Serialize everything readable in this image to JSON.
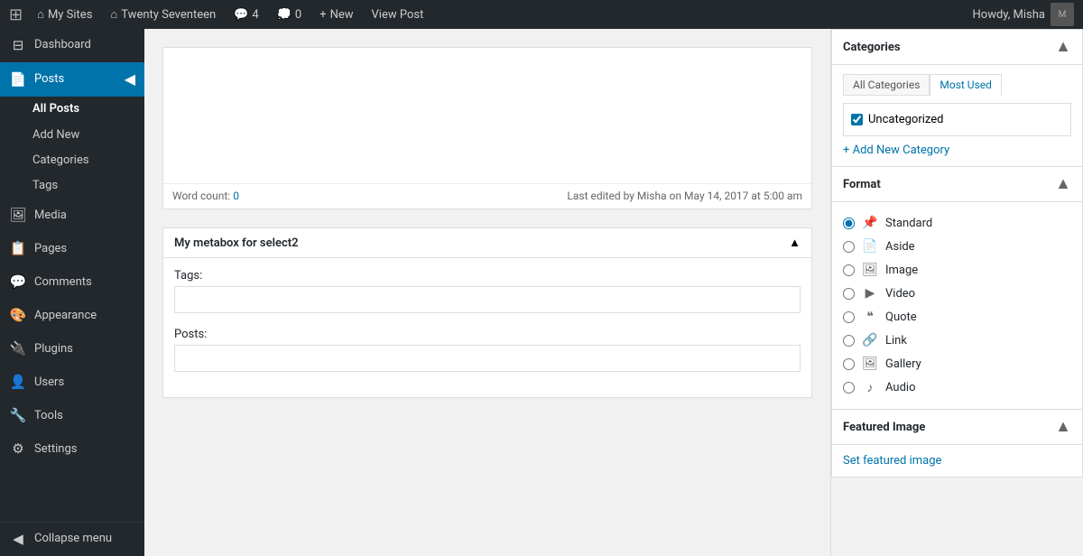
{
  "adminbar": {
    "logo": "⊞",
    "items": [
      {
        "id": "my-sites",
        "icon": "⌂",
        "label": "My Sites"
      },
      {
        "id": "site-name",
        "icon": "⌂",
        "label": "Twenty Seventeen"
      },
      {
        "id": "comments",
        "icon": "💬",
        "label": "4"
      },
      {
        "id": "bubbles",
        "icon": "💭",
        "label": "0"
      },
      {
        "id": "new",
        "icon": "+",
        "label": "New"
      },
      {
        "id": "view-post",
        "label": "View Post"
      }
    ],
    "howdy": "Howdy, Misha"
  },
  "sidebar": {
    "items": [
      {
        "id": "dashboard",
        "icon": "⊟",
        "label": "Dashboard"
      },
      {
        "id": "posts",
        "icon": "📄",
        "label": "Posts",
        "active": true
      },
      {
        "id": "all-posts",
        "label": "All Posts",
        "sub": true,
        "active": true
      },
      {
        "id": "add-new",
        "label": "Add New",
        "sub": true
      },
      {
        "id": "categories",
        "label": "Categories",
        "sub": true
      },
      {
        "id": "tags",
        "label": "Tags",
        "sub": true
      },
      {
        "id": "media",
        "icon": "🖼",
        "label": "Media"
      },
      {
        "id": "pages",
        "icon": "📋",
        "label": "Pages"
      },
      {
        "id": "comments",
        "icon": "💬",
        "label": "Comments"
      },
      {
        "id": "appearance",
        "icon": "🎨",
        "label": "Appearance"
      },
      {
        "id": "plugins",
        "icon": "🔌",
        "label": "Plugins"
      },
      {
        "id": "users",
        "icon": "👤",
        "label": "Users"
      },
      {
        "id": "tools",
        "icon": "🔧",
        "label": "Tools"
      },
      {
        "id": "settings",
        "icon": "⚙",
        "label": "Settings"
      }
    ],
    "collapse_label": "Collapse menu"
  },
  "editor": {
    "word_count_label": "Word count:",
    "word_count_value": "0",
    "last_edited": "Last edited by Misha on May 14, 2017 at 5:00 am"
  },
  "metabox": {
    "title": "My metabox for select2",
    "tags_label": "Tags:",
    "posts_label": "Posts:"
  },
  "categories_panel": {
    "title": "Categories",
    "tab_all": "All Categories",
    "tab_most_used": "Most Used",
    "items": [
      {
        "label": "Uncategorized",
        "checked": true
      }
    ],
    "add_new_label": "+ Add New Category"
  },
  "format_panel": {
    "title": "Format",
    "options": [
      {
        "id": "standard",
        "label": "Standard",
        "icon": "📌",
        "checked": true
      },
      {
        "id": "aside",
        "label": "Aside",
        "icon": "📄",
        "checked": false
      },
      {
        "id": "image",
        "label": "Image",
        "icon": "🖼",
        "checked": false
      },
      {
        "id": "video",
        "label": "Video",
        "icon": "▶",
        "checked": false
      },
      {
        "id": "quote",
        "label": "Quote",
        "icon": "❝",
        "checked": false
      },
      {
        "id": "link",
        "label": "Link",
        "icon": "🔗",
        "checked": false
      },
      {
        "id": "gallery",
        "label": "Gallery",
        "icon": "🖼",
        "checked": false
      },
      {
        "id": "audio",
        "label": "Audio",
        "icon": "♪",
        "checked": false
      }
    ]
  },
  "featured_image_panel": {
    "title": "Featured Image",
    "set_link": "Set featured image"
  }
}
